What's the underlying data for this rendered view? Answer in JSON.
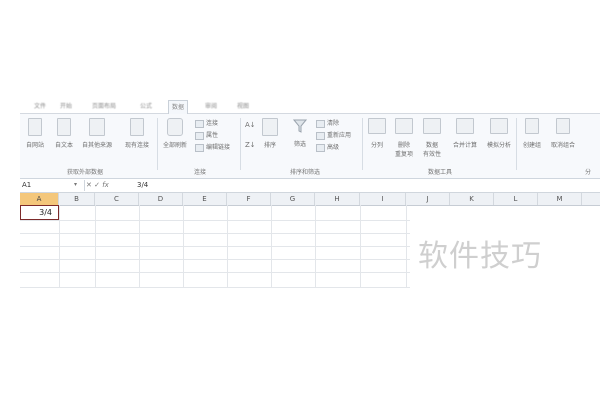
{
  "ribbon": {
    "tabs": [
      "文件",
      "开始",
      "页面布局",
      "公式",
      "数据",
      "审阅",
      "视图"
    ],
    "get_external_data": {
      "buttons": [
        "自网站",
        "自文本",
        "自其他来源",
        "现有连接"
      ],
      "group_label": "获取外部数据"
    },
    "connections": {
      "refresh_all": "全部刷新",
      "items": [
        "连接",
        "属性",
        "编辑链接"
      ],
      "group_label": "连接"
    },
    "sort_filter": {
      "sort": "排序",
      "filter": "筛选",
      "items": [
        "清除",
        "重新应用",
        "高级"
      ],
      "group_label": "排序和筛选"
    },
    "data_tools": {
      "text_to_columns": "分列",
      "remove_duplicates_1": "删除",
      "remove_duplicates_2": "重复项",
      "validation_1": "数据",
      "validation_2": "有效性",
      "consolidate": "合并计算",
      "what_if": "模拟分析",
      "group_label": "数据工具"
    },
    "outline": {
      "group": "创建组",
      "ungroup": "取消组合",
      "group_label": "分"
    }
  },
  "formula_bar": {
    "name_box": "A1",
    "fx": "fx",
    "content": "3/4"
  },
  "grid": {
    "columns": [
      "A",
      "B",
      "C",
      "D",
      "E",
      "F",
      "G",
      "H",
      "I",
      "J",
      "K",
      "L",
      "M"
    ],
    "active_cell_value": "3/4"
  },
  "watermark": "软件技巧",
  "colors": {
    "selected_column_header": "#f4c77b",
    "active_cell_border": "#7c2a2a"
  }
}
